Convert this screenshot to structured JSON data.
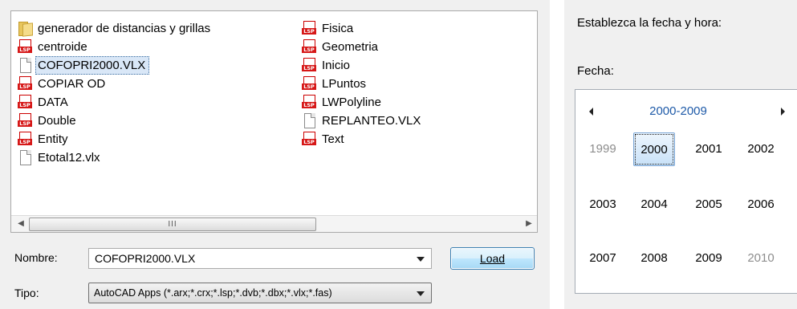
{
  "file_dialog": {
    "files_left": [
      {
        "name": "generador de distancias y grillas",
        "icon": "folder-icon",
        "selected": false
      },
      {
        "name": "centroide",
        "icon": "lsp-file-icon",
        "selected": false
      },
      {
        "name": "COFOPRI2000.VLX",
        "icon": "document-icon",
        "selected": true
      },
      {
        "name": "COPIAR OD",
        "icon": "lsp-file-icon",
        "selected": false
      },
      {
        "name": "DATA",
        "icon": "lsp-file-icon",
        "selected": false
      },
      {
        "name": "Double",
        "icon": "lsp-file-icon",
        "selected": false
      },
      {
        "name": "Entity",
        "icon": "lsp-file-icon",
        "selected": false
      },
      {
        "name": "Etotal12.vlx",
        "icon": "document-icon",
        "selected": false
      }
    ],
    "files_right": [
      {
        "name": "Fisica",
        "icon": "lsp-file-icon",
        "selected": false
      },
      {
        "name": "Geometria",
        "icon": "lsp-file-icon",
        "selected": false
      },
      {
        "name": "Inicio",
        "icon": "lsp-file-icon",
        "selected": false
      },
      {
        "name": "LPuntos",
        "icon": "lsp-file-icon",
        "selected": false
      },
      {
        "name": "LWPolyline",
        "icon": "lsp-file-icon",
        "selected": false
      },
      {
        "name": "REPLANTEO.VLX",
        "icon": "document-icon",
        "selected": false
      },
      {
        "name": "Text",
        "icon": "lsp-file-icon",
        "selected": false
      }
    ],
    "scrollbar_thumb_grip": "III",
    "name_label": "Nombre:",
    "name_value": "COFOPRI2000.VLX",
    "load_button": "Load",
    "type_label": "Tipo:",
    "type_value": "AutoCAD Apps (*.arx;*.crx;*.lsp;*.dvb;*.dbx;*.vlx;*.fas)"
  },
  "date_picker": {
    "prompt": "Establezca la fecha y hora:",
    "date_label": "Fecha:",
    "decade_header": "2000-2009",
    "years": [
      {
        "label": "1999",
        "muted": true,
        "selected": false
      },
      {
        "label": "2000",
        "muted": false,
        "selected": true
      },
      {
        "label": "2001",
        "muted": false,
        "selected": false
      },
      {
        "label": "2002",
        "muted": false,
        "selected": false
      },
      {
        "label": "2003",
        "muted": false,
        "selected": false
      },
      {
        "label": "2004",
        "muted": false,
        "selected": false
      },
      {
        "label": "2005",
        "muted": false,
        "selected": false
      },
      {
        "label": "2006",
        "muted": false,
        "selected": false
      },
      {
        "label": "2007",
        "muted": false,
        "selected": false
      },
      {
        "label": "2008",
        "muted": false,
        "selected": false
      },
      {
        "label": "2009",
        "muted": false,
        "selected": false
      },
      {
        "label": "2010",
        "muted": true,
        "selected": false
      }
    ]
  }
}
